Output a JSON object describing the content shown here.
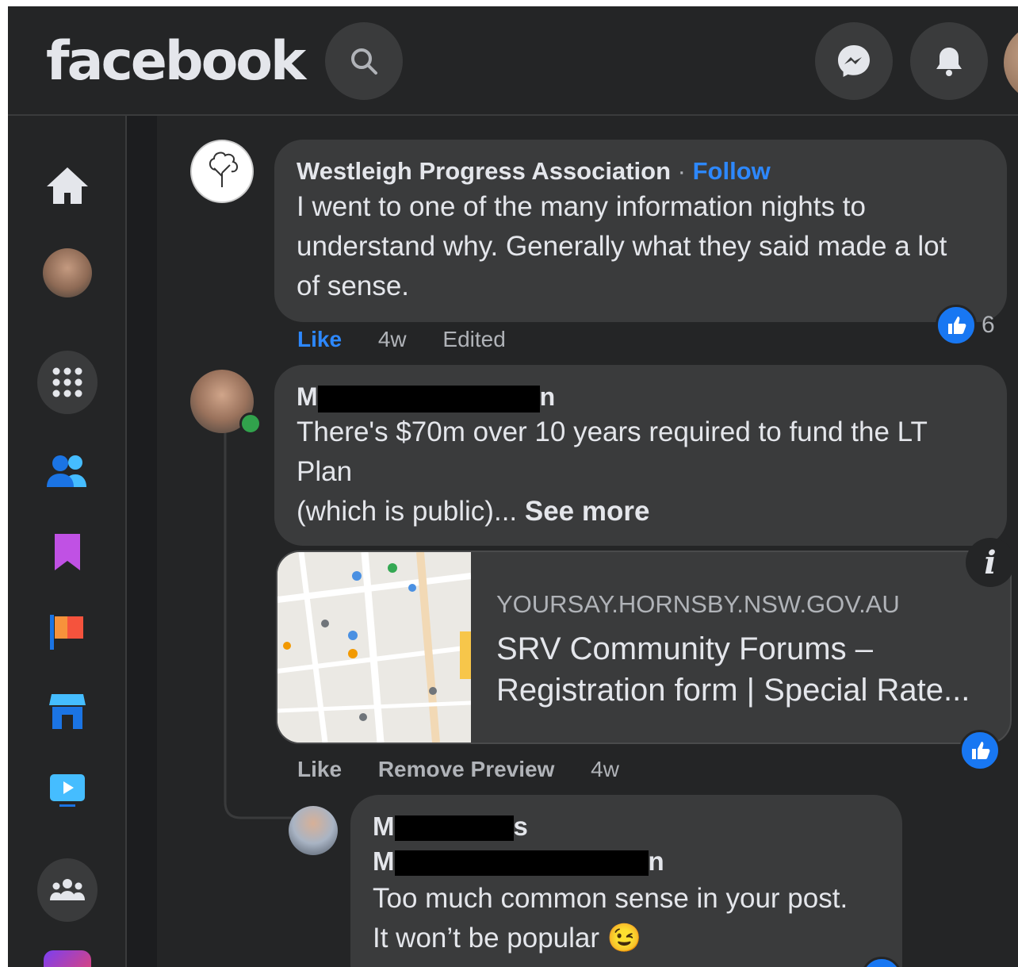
{
  "header": {
    "logo": "facebook",
    "icons": [
      "search-icon",
      "messenger-icon",
      "bell-icon",
      "profile-avatar"
    ]
  },
  "sidebar": {
    "icons": [
      "home-icon",
      "profile-avatar",
      "apps-grid-icon",
      "friends-icon",
      "saved-bookmark-icon",
      "pages-flag-icon",
      "marketplace-store-icon",
      "watch-video-icon",
      "groups-icon"
    ]
  },
  "comments": [
    {
      "author": "Westleigh Progress Association",
      "separator": "·",
      "follow_label": "Follow",
      "text": "I went to one of the many information nights to understand why. Generally what they said made a lot of sense.",
      "like_label": "Like",
      "time": "4w",
      "edited": "Edited",
      "reaction_count": "6"
    },
    {
      "author_start": "M",
      "author_end": "n",
      "text_line1": "There's $70m over 10 years required to fund the LT Plan",
      "text_line2": "(which is public)...",
      "see_more": "See more",
      "link_preview": {
        "domain": "YOURSAY.HORNSBY.NSW.GOV.AU",
        "title": "SRV Community Forums – Registration form | Special Rate..."
      },
      "like_label": "Like",
      "remove_preview_label": "Remove Preview",
      "time": "4w"
    },
    {
      "author_line1_start": "M",
      "author_line1_end": "s",
      "author_line2_start": "M",
      "author_line2_end": "n",
      "text_line1": "Too much common sense in your post.",
      "text_line2": "It won’t be popular",
      "emoji": "😉"
    }
  ],
  "colors": {
    "background": "#18191a",
    "surface": "#242526",
    "bubble": "#3a3b3c",
    "accent": "#2d88ff",
    "text": "#e4e6eb",
    "secondary_text": "#b0b3b8"
  }
}
